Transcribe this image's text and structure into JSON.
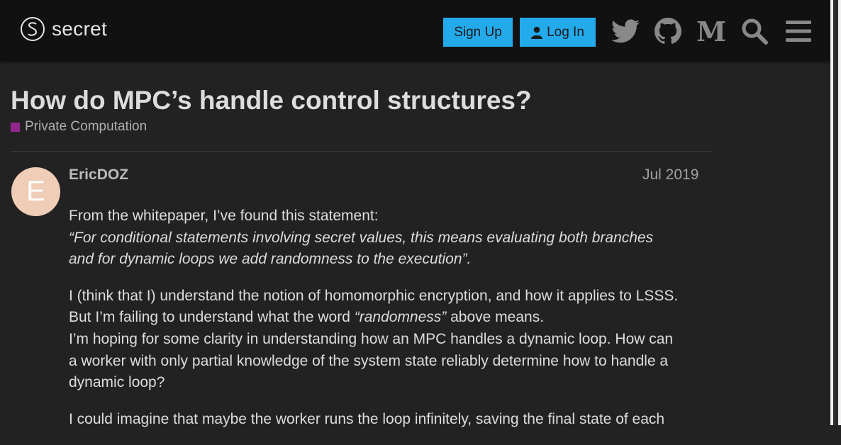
{
  "header": {
    "logo_text": "secret",
    "signup_label": "Sign Up",
    "login_label": "Log In",
    "icons": [
      "twitter-icon",
      "github-icon",
      "medium-icon",
      "search-icon",
      "hamburger-menu-icon"
    ]
  },
  "topic": {
    "title": "How do MPC’s handle control structures?",
    "category": "Private Computation",
    "category_color": "#92278f"
  },
  "post": {
    "avatar_letter": "E",
    "avatar_color": "#f0cdb7",
    "author": "EricDOZ",
    "date": "Jul 2019",
    "p1_l1": "From the whitepaper, I’ve found this statement:",
    "p1_l2": "“For conditional statements involving secret values, this means evaluating both branches",
    "p1_l3": "and for dynamic loops we add randomness to the execution”.",
    "p2_l1": "I (think that I) understand the notion of homomorphic encryption, and how it applies to LSSS.",
    "p2_l2a": "But I’m failing to understand what the word ",
    "p2_l2b": "“randomness”",
    "p2_l2c": " above means.",
    "p2_l3": "I’m hoping for some clarity in understanding how an MPC handles a dynamic loop. How can",
    "p2_l4": "a worker with only partial knowledge of the system state reliably determine how to handle a",
    "p2_l5": "dynamic loop?",
    "p3_l1": "I could imagine that maybe the worker runs the loop infinitely, saving the final state of each"
  }
}
